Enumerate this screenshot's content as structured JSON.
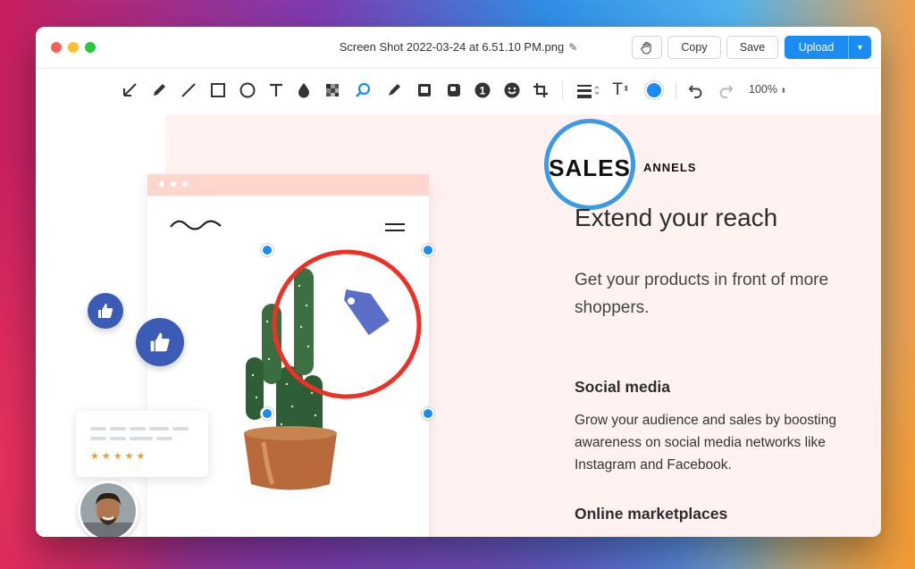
{
  "window": {
    "title": "Screen Shot 2022-03-24 at 6.51.10 PM.png",
    "edit_icon": "pencil-icon"
  },
  "actions": {
    "hand_icon": "hand-icon",
    "copy_label": "Copy",
    "save_label": "Save",
    "upload_label": "Upload",
    "upload_menu_icon": "caret-down-icon",
    "accent": "#1a8cf2"
  },
  "toolbar": {
    "tools": [
      "arrow-icon",
      "pencil-icon",
      "line-icon",
      "rectangle-icon",
      "ellipse-icon",
      "text-icon",
      "blur-drop-icon",
      "pixelate-icon",
      "magnifier-icon",
      "highlighter-icon",
      "filled-rect-icon",
      "rounded-rect-icon",
      "counter-icon",
      "emoji-icon",
      "crop-icon"
    ],
    "counter_label": "1",
    "selected_tool": "magnifier-icon",
    "line_width_icon": "line-width-icon",
    "font_size_icon": "font-size-icon",
    "font_size_label": "T",
    "color": "#1a8cf2",
    "undo_icon": "undo-icon",
    "redo_icon": "redo-icon",
    "zoom": "100%"
  },
  "document": {
    "eyebrow": "ANNELS",
    "magnified_text": "SALES",
    "heading": "Extend your reach",
    "lead": "Get your products in front of more shoppers.",
    "section1_title": "Social media",
    "section1_body": "Grow your audience and sales by boosting awareness on social media networks like Instagram and Facebook.",
    "section2_title": "Online marketplaces",
    "rating_stars": "★★★★★",
    "annotation_color": "#ee3124",
    "magnifier_color": "#3b9ae8"
  }
}
